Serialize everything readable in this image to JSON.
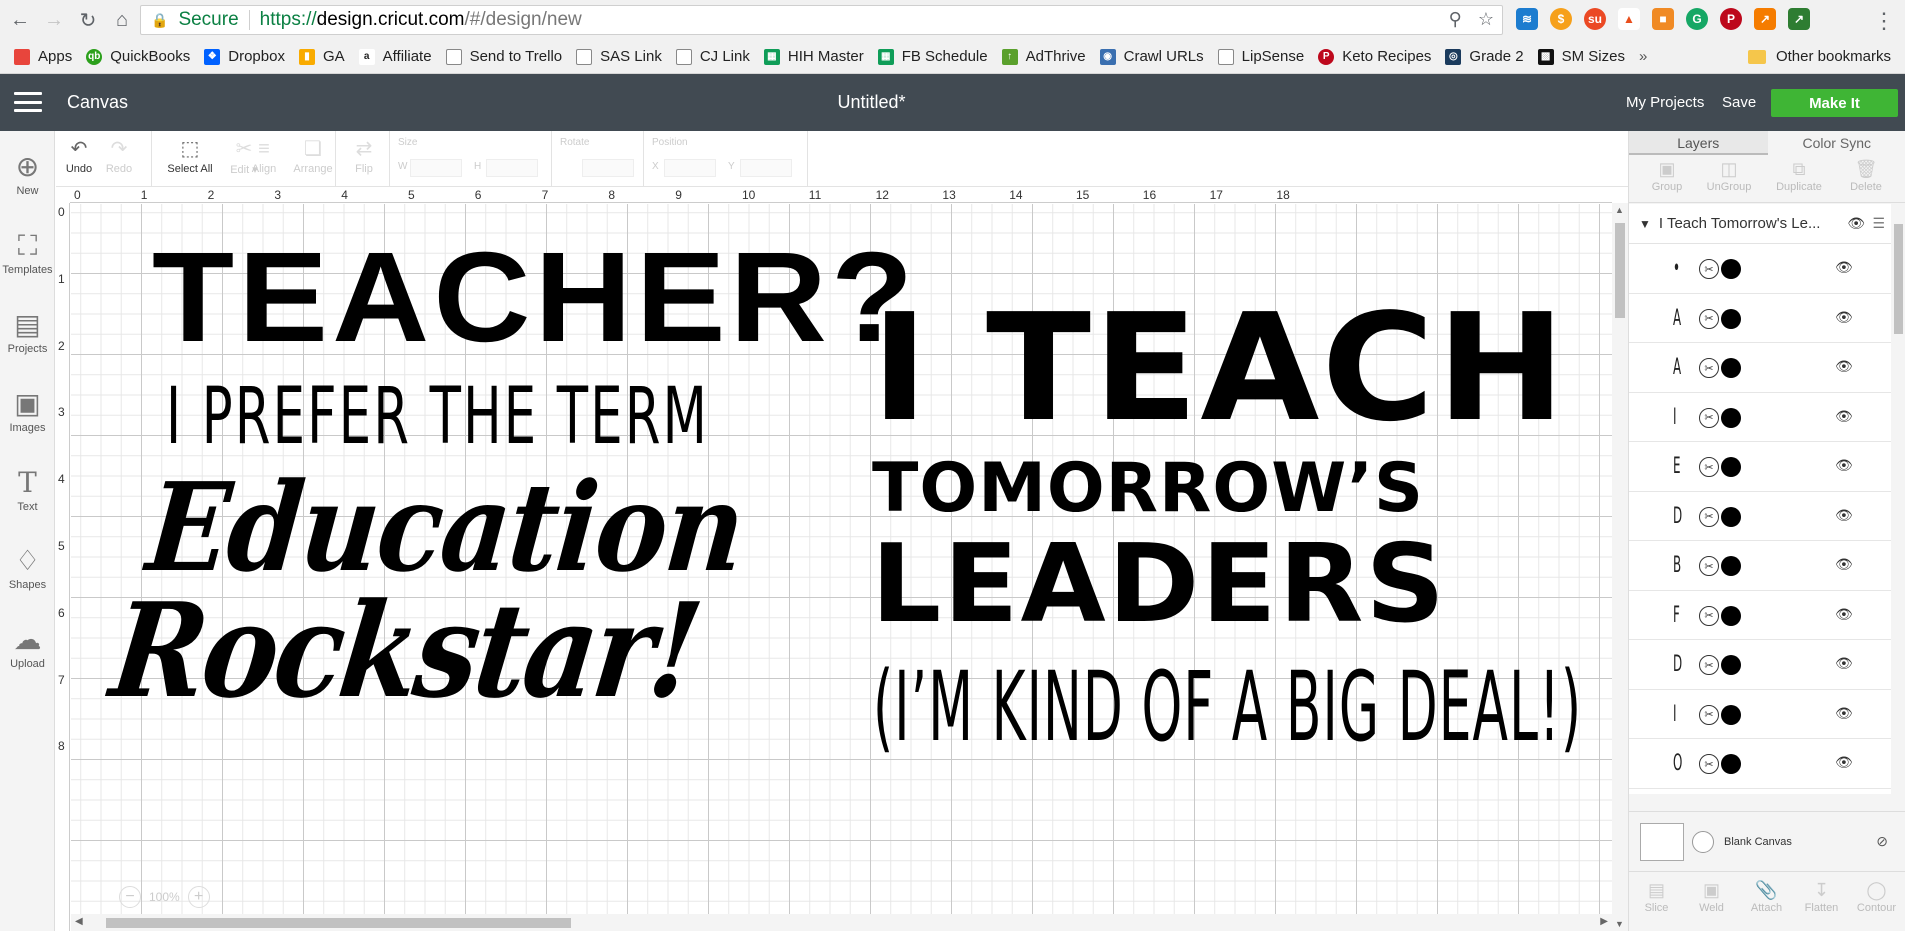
{
  "browser": {
    "secure_label": "Secure",
    "url_scheme": "https://",
    "url_host": "design.cricut.com",
    "url_path": "/#/design/new",
    "bookmarks": [
      {
        "label": "Apps",
        "icon": "apps-grid-icon",
        "color": "#e8453c"
      },
      {
        "label": "QuickBooks",
        "icon": "quickbooks-icon",
        "color": "#2ca01c"
      },
      {
        "label": "Dropbox",
        "icon": "dropbox-icon",
        "color": "#0061ff"
      },
      {
        "label": "GA",
        "icon": "analytics-icon",
        "color": "#f9ab00"
      },
      {
        "label": "Affiliate",
        "icon": "amazon-icon",
        "color": "#222222"
      },
      {
        "label": "Send to Trello",
        "icon": "page-icon",
        "color": "#888888"
      },
      {
        "label": "SAS Link",
        "icon": "page-icon",
        "color": "#888888"
      },
      {
        "label": "CJ  Link",
        "icon": "page-icon",
        "color": "#888888"
      },
      {
        "label": "HIH Master",
        "icon": "sheets-icon",
        "color": "#0f9d58"
      },
      {
        "label": "FB Schedule",
        "icon": "sheets-icon",
        "color": "#0f9d58"
      },
      {
        "label": "AdThrive",
        "icon": "adthrive-icon",
        "color": "#5aa02c"
      },
      {
        "label": "Crawl URLs",
        "icon": "crawl-icon",
        "color": "#3a6fb0"
      },
      {
        "label": "LipSense",
        "icon": "page-icon",
        "color": "#888888"
      },
      {
        "label": "Keto Recipes",
        "icon": "pinterest-icon",
        "color": "#bd081c"
      },
      {
        "label": "Grade 2",
        "icon": "grade-icon",
        "color": "#1a3a5c"
      },
      {
        "label": "SM Sizes",
        "icon": "smsizes-icon",
        "color": "#111111"
      }
    ],
    "more_label": "»",
    "other_bookmarks": "Other bookmarks"
  },
  "topbar": {
    "app_name": "Canvas",
    "doc_title": "Untitled*",
    "my_projects": "My Projects",
    "save": "Save",
    "make_it": "Make It"
  },
  "sidebar": {
    "items": [
      {
        "label": "New",
        "icon": "plus-icon"
      },
      {
        "label": "Templates",
        "icon": "shirt-icon"
      },
      {
        "label": "Projects",
        "icon": "projects-icon"
      },
      {
        "label": "Images",
        "icon": "image-icon"
      },
      {
        "label": "Text",
        "icon": "text-icon"
      },
      {
        "label": "Shapes",
        "icon": "shapes-icon"
      },
      {
        "label": "Upload",
        "icon": "upload-icon"
      }
    ]
  },
  "toolbar": {
    "undo": "Undo",
    "redo": "Redo",
    "select_all": "Select All",
    "edit": "Edit",
    "align": "Align",
    "arrange": "Arrange",
    "flip": "Flip",
    "size": "Size",
    "w": "W",
    "h": "H",
    "rotate": "Rotate",
    "position": "Position",
    "x": "X",
    "y": "Y"
  },
  "canvas": {
    "ruler_top": [
      "0",
      "1",
      "2",
      "3",
      "4",
      "5",
      "6",
      "7",
      "8",
      "9",
      "10",
      "11",
      "12",
      "13",
      "14",
      "15",
      "16",
      "17",
      "18"
    ],
    "ruler_left": [
      "0",
      "1",
      "2",
      "3",
      "4",
      "5",
      "6",
      "7",
      "8"
    ],
    "zoom": "100%",
    "design_left": {
      "line1": "TEACHER?",
      "line2": "I PREFER THE TERM",
      "line3": "Education",
      "line4": "Rockstar!"
    },
    "design_right": {
      "line1": "I TEACH",
      "line2": "TOMORROW’S",
      "line3": "LEADERS",
      "line4": "(I’M KIND OF A BIG DEAL!)"
    }
  },
  "right_panel": {
    "tabs": [
      "Layers",
      "Color Sync"
    ],
    "actions": [
      "Group",
      "UnGroup",
      "Duplicate",
      "Delete"
    ],
    "group_name": "I Teach Tomorrow's Le...",
    "layers": [
      "•",
      "A",
      "A",
      "I",
      "E",
      "D",
      "B",
      "F",
      "D",
      "I",
      "O"
    ],
    "blank_canvas": "Blank Canvas",
    "bottom_actions": [
      "Slice",
      "Weld",
      "Attach",
      "Flatten",
      "Contour"
    ]
  }
}
